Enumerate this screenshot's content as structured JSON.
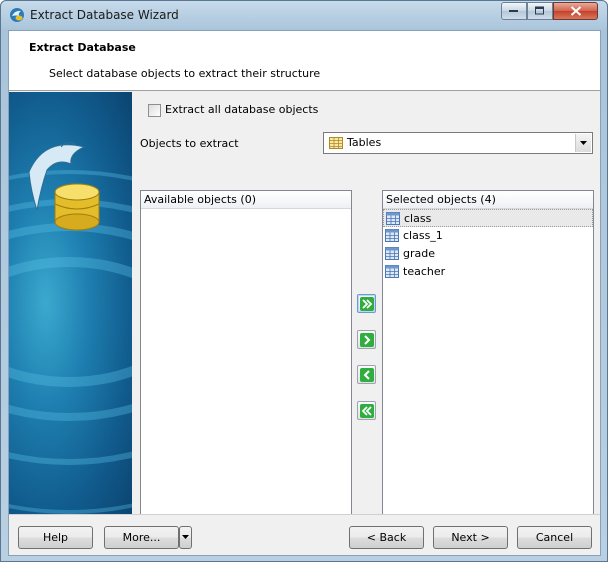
{
  "window": {
    "title": "Extract Database Wizard"
  },
  "header": {
    "title": "Extract Database",
    "subtitle": "Select database objects to extract their structure"
  },
  "options": {
    "extract_all_label": "Extract all database objects",
    "extract_all_checked": false,
    "objects_to_extract_label": "Objects to extract",
    "object_type_selected": "Tables"
  },
  "available": {
    "header": "Available objects (0)",
    "items": []
  },
  "selected": {
    "header": "Selected objects (4)",
    "items": [
      {
        "label": "class",
        "icon": "table-icon"
      },
      {
        "label": "class_1",
        "icon": "table-icon"
      },
      {
        "label": "grade",
        "icon": "table-icon"
      },
      {
        "label": "teacher",
        "icon": "table-icon"
      }
    ]
  },
  "buttons": {
    "help": "Help",
    "more": "More...",
    "back": "< Back",
    "next": "Next >",
    "cancel": "Cancel"
  },
  "colors": {
    "move_button_arrow": "#1f9a2e",
    "side_image_blue": "#1e7fb0"
  }
}
